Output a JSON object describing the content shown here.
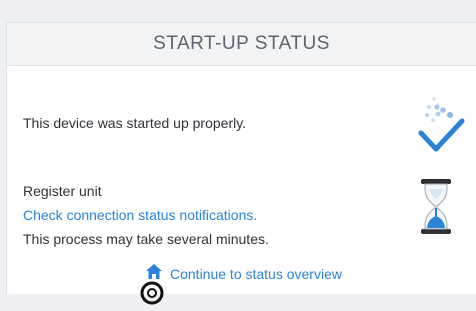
{
  "card": {
    "title": "START-UP STATUS"
  },
  "status": {
    "started_text": "This device was started up properly.",
    "started_icon": "checkmark-icon",
    "register_label": "Register unit",
    "register_icon": "hourglass-icon",
    "check_link": "Check connection status notifications.",
    "note_text": "This process may take several minutes."
  },
  "footer": {
    "continue_label": "Continue to status overview",
    "continue_icon": "home-icon"
  },
  "colors": {
    "link": "#2b83d8",
    "checkmark": "#2b83d8",
    "hourglass_sand": "#2b83d8",
    "header_bg": "#f3f4f6"
  }
}
